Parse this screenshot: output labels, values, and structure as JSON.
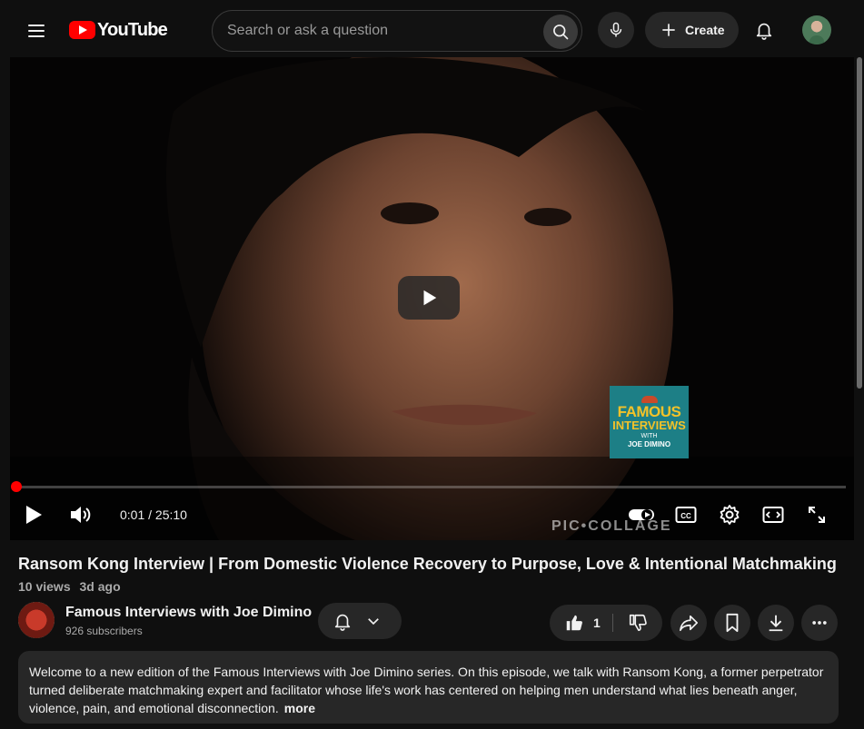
{
  "header": {
    "logo_text": "YouTube",
    "search_placeholder": "Search or ask a question",
    "create_label": "Create"
  },
  "player": {
    "current_time": "0:01",
    "separator": "/",
    "duration": "25:10",
    "progress_fraction": 0.001,
    "badge": {
      "line1": "FAMOUS",
      "line2": "INTERVIEWS",
      "line3": "WITH",
      "line4": "JOE DIMINO"
    },
    "watermark": "PIC•COLLAGE"
  },
  "video": {
    "title": "Ransom Kong Interview | From Domestic Violence Recovery to Purpose, Love & Intentional Matchmaking",
    "views": "10 views",
    "age": "3d ago"
  },
  "channel": {
    "name": "Famous Interviews with Joe Dimino",
    "subscribers": "926 subscribers"
  },
  "actions": {
    "like_count": "1"
  },
  "description": {
    "text": "Welcome to a new edition of the Famous Interviews with Joe Dimino series. On this episode, we talk with Ransom Kong, a former perpetrator turned deliberate matchmaking expert and facilitator whose life's work has centered on helping men understand what lies beneath anger, violence, pain, and emotional disconnection.",
    "more_label": "more"
  },
  "colors": {
    "brand_red": "#ff0000",
    "background": "#0f0f0f",
    "chip": "#272727"
  }
}
